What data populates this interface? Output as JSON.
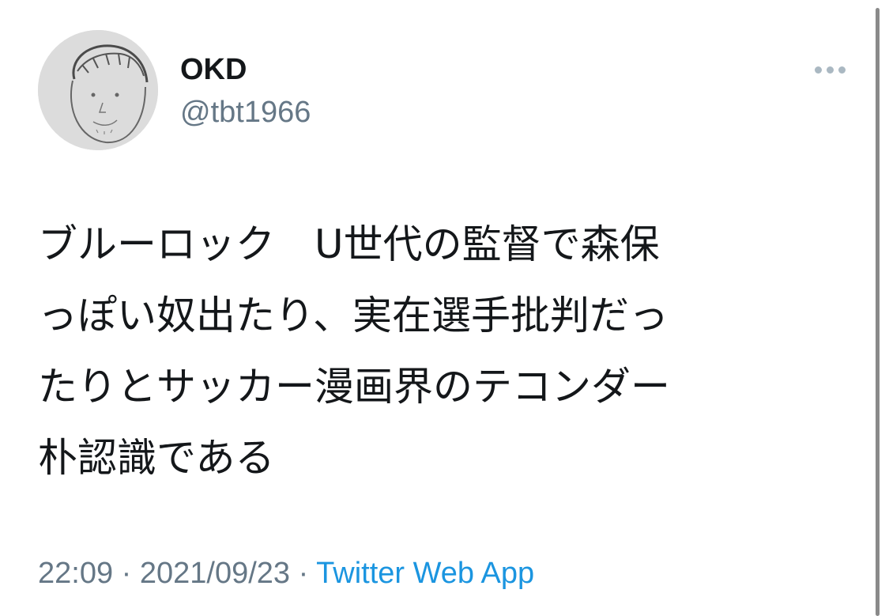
{
  "user": {
    "display_name": "OKD",
    "handle": "@tbt1966",
    "avatar": "avatar-doodle-face"
  },
  "header": {
    "more_icon": "more-horizontal-icon"
  },
  "tweet": {
    "lines": [
      "ブルーロック　U世代の監督で森保",
      "っぽい奴出たり、実在選手批判だっ",
      "たりとサッカー漫画界のテコンダー",
      "朴認識である"
    ]
  },
  "meta": {
    "time": "22:09",
    "separator": " · ",
    "date": "2021/09/23",
    "source": "Twitter Web App"
  },
  "colors": {
    "text": "#14171a",
    "secondary": "#657786",
    "link": "#1b95e0",
    "icon": "#aab8c2"
  }
}
